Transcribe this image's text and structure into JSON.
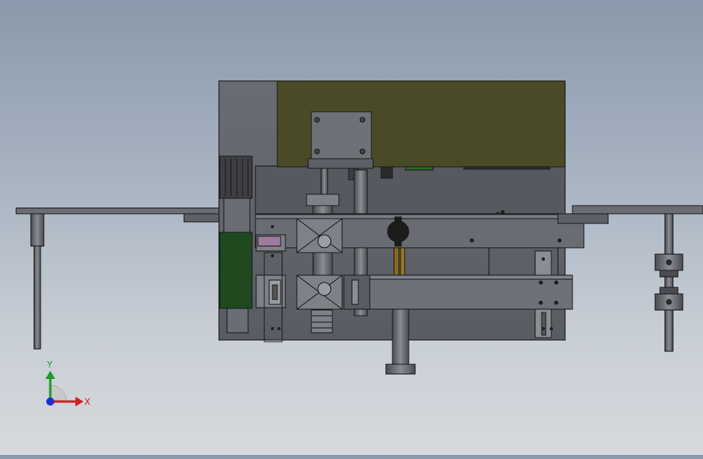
{
  "viewport": {
    "background_top": "#8a99ab",
    "background_bottom": "#d6d9dd"
  },
  "model": {
    "body_color": "#5e6068",
    "olive_housing_color": "#4b4a27",
    "motor_green_color": "#1f4a1f",
    "amber_guide_color": "#8a6a1a",
    "edge_color": "#1a1a1a"
  },
  "triad": {
    "x_label": "X",
    "y_label": "Y",
    "x_color": "#d02020",
    "y_color": "#1f9a2a",
    "z_color": "#1e2fd0"
  }
}
